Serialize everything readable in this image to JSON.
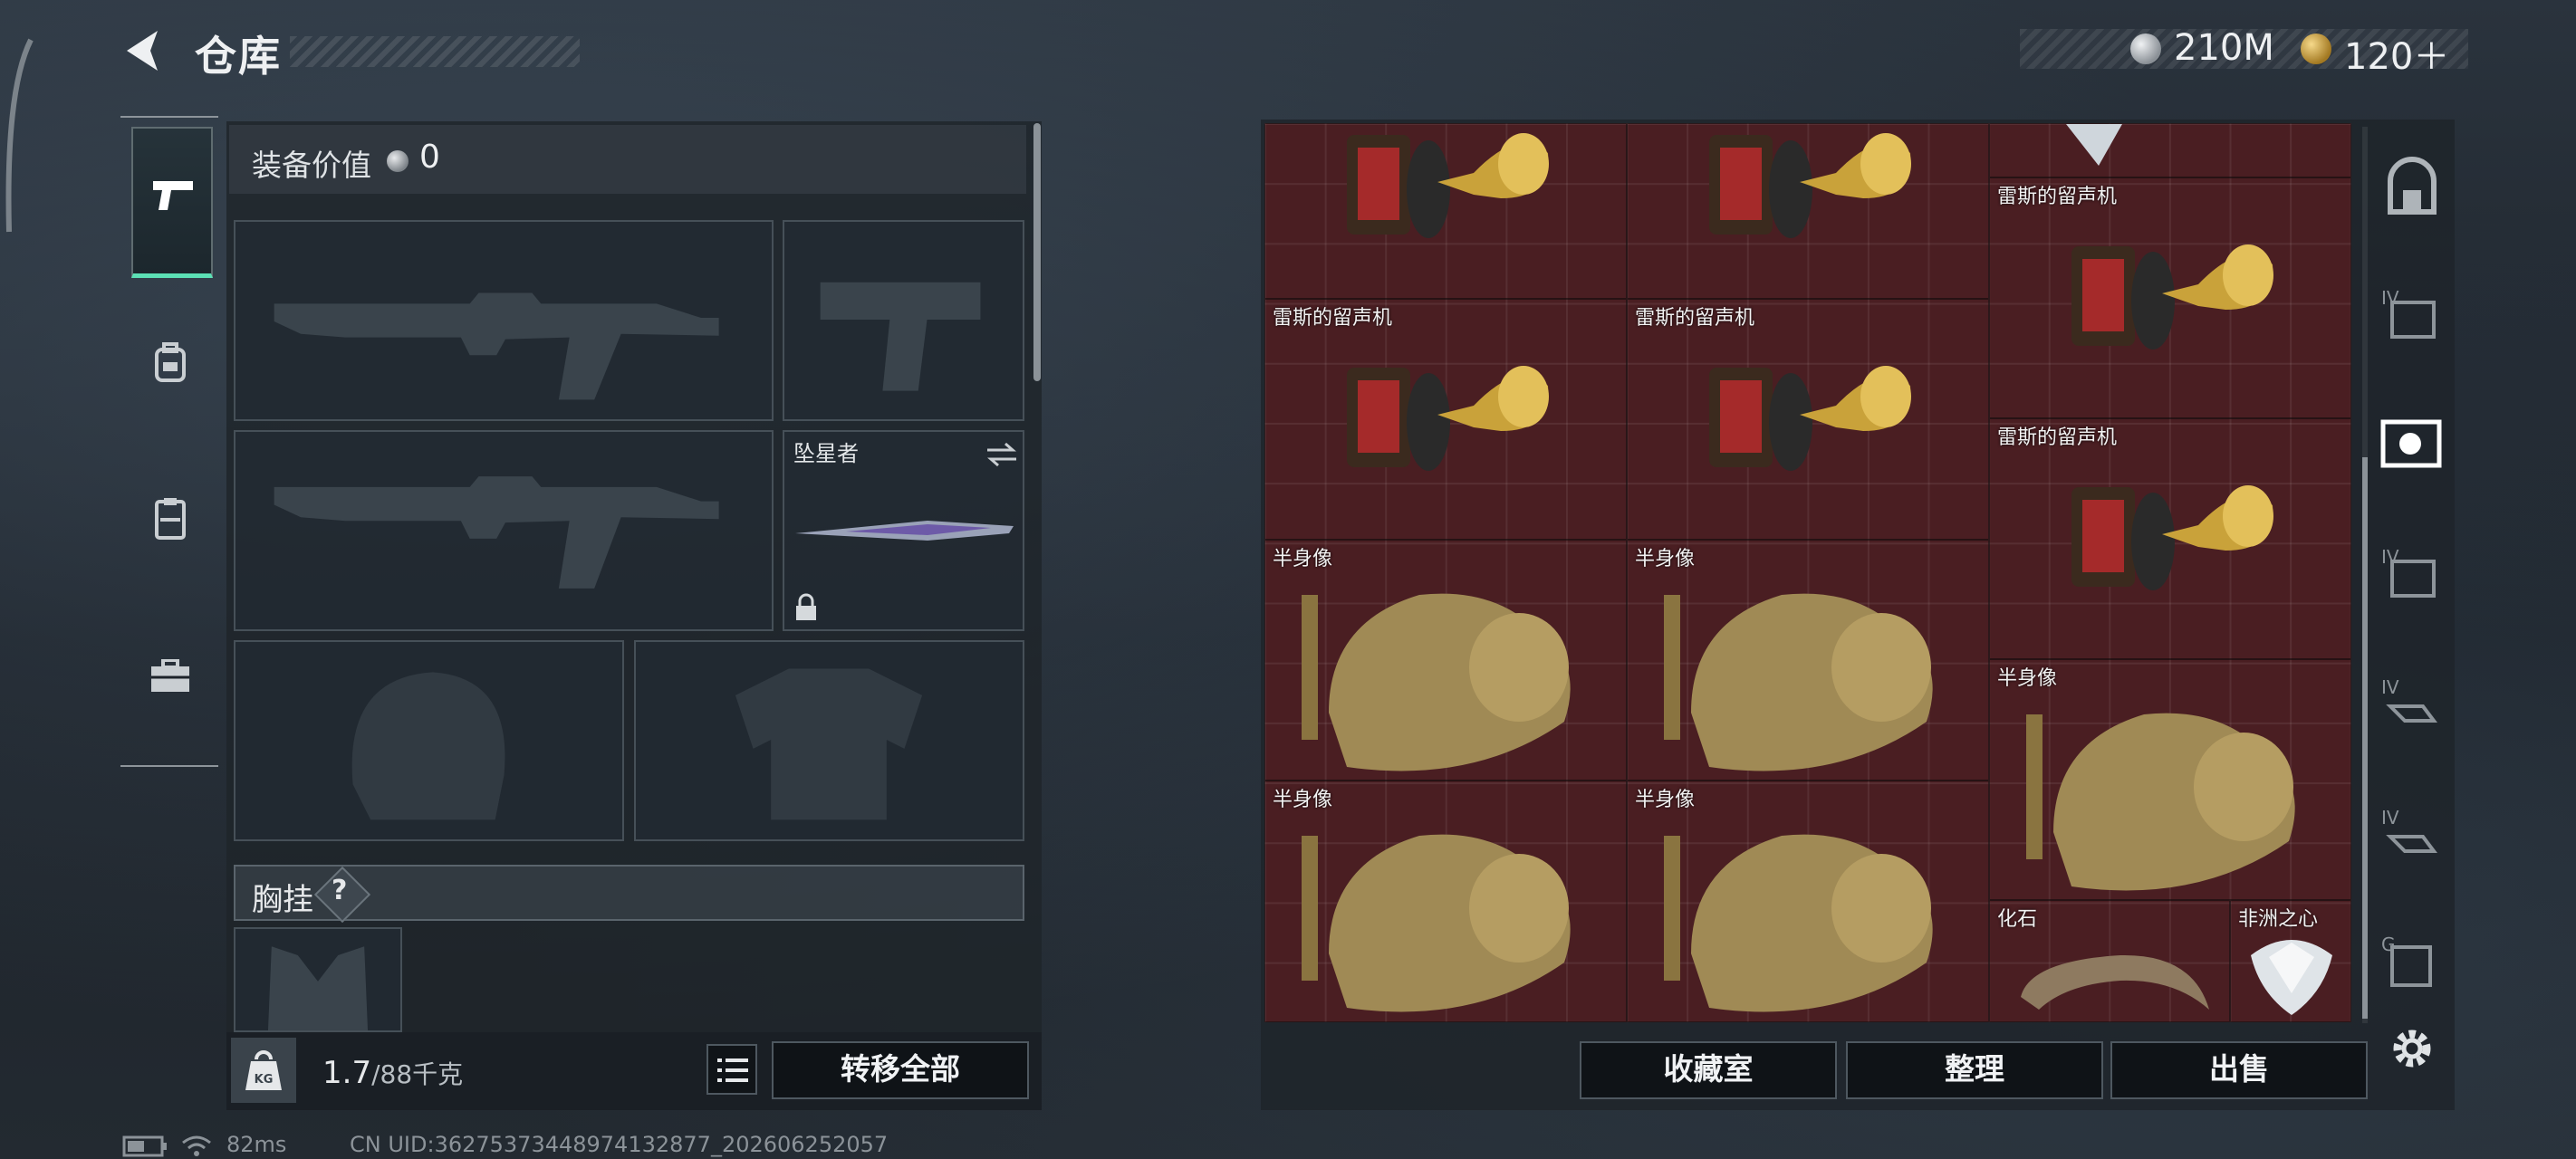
{
  "header": {
    "title": "仓库",
    "currencies": [
      {
        "icon": "silver-coin-icon",
        "value": "210M"
      },
      {
        "icon": "gold-coin-icon",
        "value": "120＋"
      }
    ]
  },
  "rail_tabs": [
    {
      "icon": "pistol-icon",
      "active": true
    },
    {
      "icon": "backpack-icon",
      "active": false
    },
    {
      "icon": "vest-icon",
      "active": false
    },
    {
      "icon": "briefcase-icon",
      "active": false
    }
  ],
  "equipment": {
    "value_label": "装备价值",
    "value": "0",
    "melee_name": "坠星者",
    "chest_label": "胸挂",
    "chest_help": "?"
  },
  "footer_left": {
    "weight": "1.7",
    "weight_cap": "/88千克",
    "weight_icon": "kg-weight-icon",
    "transfer_all": "转移全部"
  },
  "storage": {
    "items": [
      {
        "name": ""
      },
      {
        "name": ""
      },
      {
        "name": ""
      },
      {
        "name": "雷斯的留声机"
      },
      {
        "name": "雷斯的留声机"
      },
      {
        "name": "雷斯的留声机"
      },
      {
        "name": "雷斯的留声机"
      },
      {
        "name": "半身像"
      },
      {
        "name": "半身像"
      },
      {
        "name": "半身像"
      },
      {
        "name": "半身像"
      },
      {
        "name": "半身像"
      },
      {
        "name": "化石"
      },
      {
        "name": "非洲之心"
      }
    ],
    "buttons": {
      "collection": "收藏室",
      "organize": "整理",
      "sell": "出售"
    }
  },
  "side_rail": [
    {
      "icon": "safe-box-icon"
    },
    {
      "icon": "shelf-iv-icon"
    },
    {
      "icon": "collection-display-icon"
    },
    {
      "icon": "shelf-iv-icon"
    },
    {
      "icon": "shelf-iv-hand-icon"
    },
    {
      "icon": "shelf-iv-hand-icon"
    },
    {
      "icon": "shelf-g-icon"
    },
    {
      "icon": "settings-gear-icon"
    }
  ],
  "status_bar": {
    "ping": "82ms",
    "uid": "CN UID:36275373448974132877_202606252057"
  },
  "colors": {
    "accent": "#5ce0b5",
    "storage_bg": "#4a1e22"
  }
}
